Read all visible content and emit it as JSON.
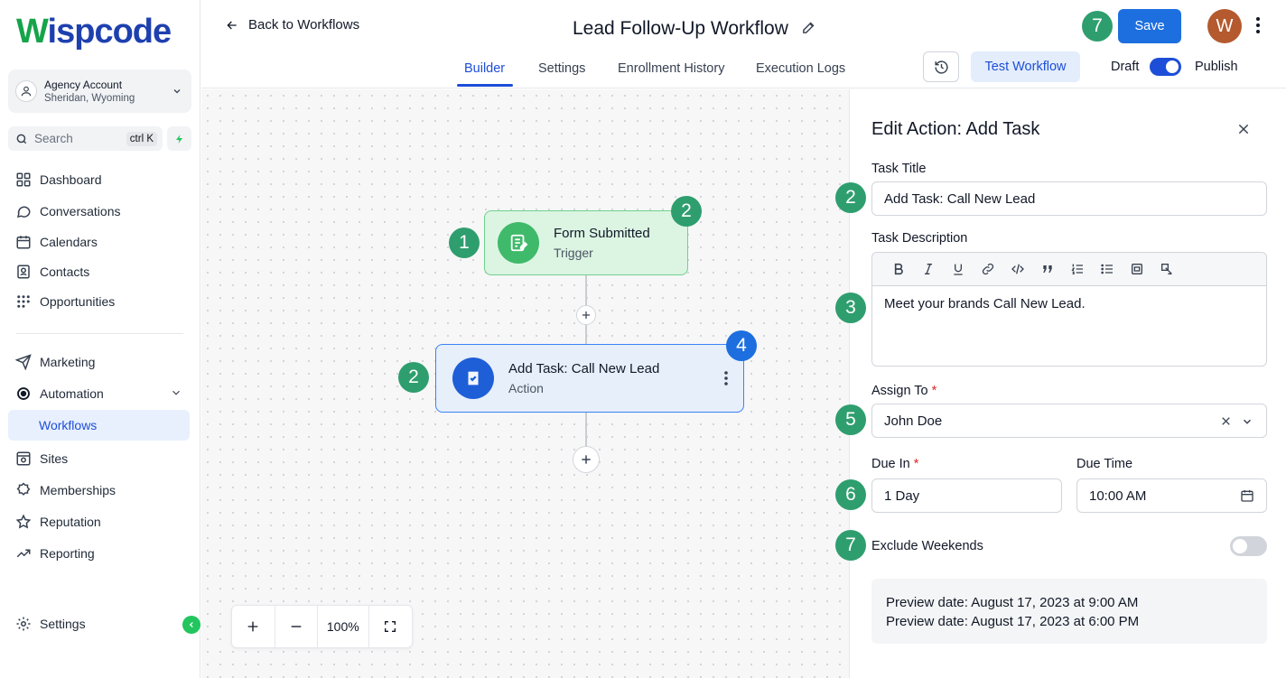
{
  "app": {
    "logo_first": "W",
    "logo_rest": "ispcode"
  },
  "sidebar": {
    "account": {
      "name": "Agency Account",
      "location": "Sheridan, Wyoming"
    },
    "search": {
      "placeholder": "Search",
      "shortcut": "ctrl K"
    },
    "items": [
      {
        "label": "Dashboard",
        "icon": "grid-icon"
      },
      {
        "label": "Conversations",
        "icon": "chat-bubble-icon"
      },
      {
        "label": "Calendars",
        "icon": "calendar-icon"
      },
      {
        "label": "Contacts",
        "icon": "contacts-icon"
      },
      {
        "label": "Opportunities",
        "icon": "opportunities-icon"
      },
      {
        "label": "Marketing",
        "icon": "send-icon"
      },
      {
        "label": "Automation",
        "icon": "automation-icon"
      },
      {
        "label": "Workflows",
        "icon": ""
      },
      {
        "label": "Sites",
        "icon": "sites-icon"
      },
      {
        "label": "Memberships",
        "icon": "badge-icon"
      },
      {
        "label": "Reputation",
        "icon": "star-icon"
      },
      {
        "label": "Reporting",
        "icon": "trend-icon"
      }
    ],
    "settings_label": "Settings"
  },
  "header": {
    "back_label": "Back to Workflows",
    "title": "Lead Follow-Up Workflow",
    "tabs": [
      "Builder",
      "Settings",
      "Enrollment History",
      "Execution Logs"
    ],
    "active_tab": "Builder",
    "test_button": "Test Workflow",
    "draft_label": "Draft",
    "publish_label": "Publish",
    "publish_toggle_on": true,
    "save_button": "Save",
    "avatar_initial": "W"
  },
  "canvas": {
    "trigger": {
      "title": "Form Submitted",
      "subtitle": "Trigger"
    },
    "action": {
      "title": "Add Task: Call New Lead",
      "subtitle": "Action"
    },
    "zoom": "100%"
  },
  "annotations": {
    "trigger_left": "1",
    "trigger_corner": "2",
    "action_left": "2",
    "action_corner": "4",
    "header_save": "7",
    "task_title": "2",
    "task_description": "3",
    "assign_to": "5",
    "due_in": "6",
    "exclude_weekends": "7"
  },
  "panel": {
    "title": "Edit Action: Add Task",
    "task_title_label": "Task Title",
    "task_title_value": "Add Task: Call New Lead",
    "task_description_label": "Task Description",
    "task_description_value": "Meet your brands Call New Lead.",
    "assign_to_label": "Assign To",
    "assign_to_value": "John Doe",
    "due_in_label": "Due In",
    "due_in_value": "1 Day",
    "due_time_label": "Due Time",
    "due_time_value": "10:00 AM",
    "required_mark": "*",
    "exclude_weekends_label": "Exclude Weekends",
    "exclude_weekends_on": false,
    "preview_lines": [
      "Preview date: August 17, 2023 at 9:00 AM",
      "Preview date: August 17, 2023 at 6:00 PM"
    ]
  },
  "colors": {
    "accent": "#1d6fe0",
    "trigger_green": "#3fba6a",
    "badge_green": "#2f9e6e",
    "active_nav_bg": "#e8f0fd"
  }
}
